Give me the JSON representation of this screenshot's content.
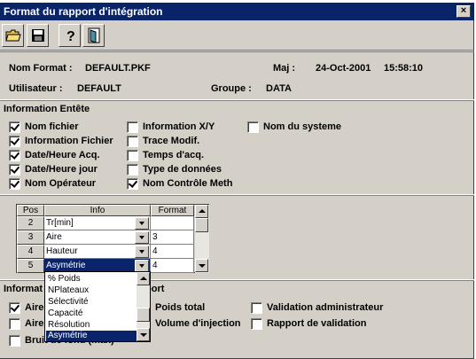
{
  "window": {
    "title": "Format du rapport d'intégration",
    "close_label": "×"
  },
  "toolbar": {
    "icons": [
      "open-folder-icon",
      "save-disk-icon",
      "help-question-icon",
      "exit-door-icon"
    ]
  },
  "header": {
    "format_label": "Nom Format :",
    "format_value": "DEFAULT.PKF",
    "maj_label": "Maj :",
    "maj_date": "24-Oct-2001",
    "maj_time": "15:58:10",
    "user_label": "Utilisateur :",
    "user_value": "DEFAULT",
    "group_label": "Groupe :",
    "group_value": "DATA"
  },
  "entete": {
    "title": "Information Entête",
    "options": [
      {
        "label": "Nom fichier",
        "checked": true
      },
      {
        "label": "Information Fichier",
        "checked": true
      },
      {
        "label": "Date/Heure Acq.",
        "checked": true
      },
      {
        "label": "Date/Heure jour",
        "checked": true
      },
      {
        "label": "Nom Opérateur",
        "checked": true
      },
      {
        "label": "Information X/Y",
        "checked": false
      },
      {
        "label": "Trace Modif.",
        "checked": false
      },
      {
        "label": "Temps d'acq.",
        "checked": false
      },
      {
        "label": "Type de données",
        "checked": false
      },
      {
        "label": "Nom Contrôle Meth",
        "checked": true
      },
      {
        "label": "Nom du systeme",
        "checked": false
      }
    ]
  },
  "grid": {
    "headers": {
      "pos": "Pos",
      "info": "Info",
      "format": "Format"
    },
    "rows": [
      {
        "pos": "2",
        "info": "Tr[min]",
        "format": ""
      },
      {
        "pos": "3",
        "info": "Aire",
        "format": "3"
      },
      {
        "pos": "4",
        "info": "Hauteur",
        "format": "4"
      },
      {
        "pos": "5",
        "info": "Asymétrie",
        "format": "4"
      }
    ],
    "dropdown": {
      "items": [
        "% Poids",
        "NPlateaux",
        "Sélectivité",
        "Capacité",
        "Résolution",
        "Asymétrie"
      ],
      "selected": "Asymétrie"
    }
  },
  "rapport": {
    "title_start": "Informat",
    "title_end": "port",
    "options": [
      {
        "label": "Aire",
        "checked": true
      },
      {
        "label": "Aire",
        "checked": false
      },
      {
        "label": "Bruit de fond (max)",
        "checked": false
      },
      {
        "label": "Poids total",
        "checked": false
      },
      {
        "label": "Volume d'injection",
        "checked": false
      },
      {
        "label": "Validation administrateur",
        "checked": false
      },
      {
        "label": "Rapport de validation",
        "checked": false
      }
    ]
  },
  "colors": {
    "titlebar": "#0a246a",
    "face": "#d4d0c8",
    "selection": "#0a246a"
  }
}
